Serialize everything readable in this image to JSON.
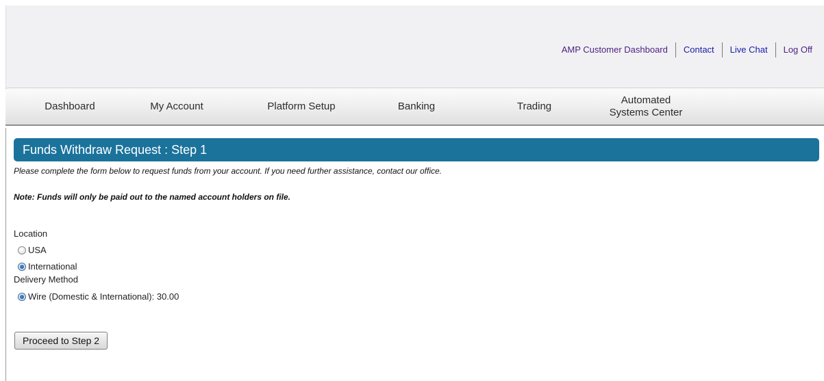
{
  "header": {
    "links": [
      {
        "label": "AMP Customer Dashboard"
      },
      {
        "label": "Contact"
      },
      {
        "label": "Live Chat"
      },
      {
        "label": "Log Off"
      }
    ]
  },
  "nav": {
    "items": [
      {
        "label": "Dashboard"
      },
      {
        "label": "My Account"
      },
      {
        "label": "Platform Setup"
      },
      {
        "label": "Banking"
      },
      {
        "label": "Trading"
      },
      {
        "label_line1": "Automated",
        "label_line2": "Systems Center"
      }
    ]
  },
  "page": {
    "title": "Funds Withdraw Request : Step 1",
    "intro": "Please complete the form below to request funds from your account. If you need further assistance, contact our office.",
    "note": "Note: Funds will only be paid out to the named account holders on file."
  },
  "form": {
    "location_label": "Location",
    "location_options": [
      {
        "label": "USA",
        "checked": false
      },
      {
        "label": "International",
        "checked": true
      }
    ],
    "delivery_label": "Delivery Method",
    "delivery_options": [
      {
        "label": "Wire (Domestic & International): 30.00",
        "checked": true
      }
    ],
    "submit_label": "Proceed to Step 2"
  }
}
